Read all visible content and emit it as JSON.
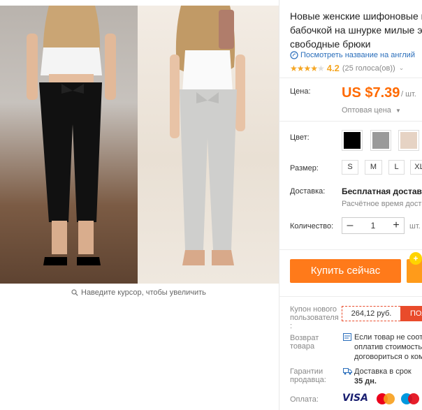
{
  "product": {
    "title_lines": [
      "Новые женские шифоновые ш",
      "бабочкой на шнурке милые эл",
      "свободные брюки"
    ],
    "translate_link": "Посмотреть название на англий",
    "rating_value": "4.2",
    "rating_votes": "(25 голоса(ов))",
    "rating_stars": 4.2
  },
  "gallery": {
    "zoom_hint": "Наведите курсор, чтобы увеличить"
  },
  "price": {
    "label": "Цена:",
    "value": "US $7.39",
    "unit": "/ шт.",
    "wholesale": "Оптовая цена"
  },
  "color": {
    "label": "Цвет:",
    "swatches": [
      "#000000",
      "#9a9a9a",
      "#e6d3c4"
    ]
  },
  "size": {
    "label": "Размер:",
    "options": [
      "S",
      "M",
      "L",
      "XL"
    ]
  },
  "shipping": {
    "label": "Доставка:",
    "value": "Бесплатная доставка",
    "sub": "Расчётное время доста"
  },
  "quantity": {
    "label": "Количество:",
    "value": "1",
    "unit": "шт.",
    "minus": "–",
    "plus": "+"
  },
  "actions": {
    "buy_now": "Купить сейчас"
  },
  "coupon": {
    "label_lines": [
      "Купон нового",
      "пользователя",
      ":"
    ],
    "amount": "264,12 руб.",
    "get": "ПОЛ"
  },
  "returns": {
    "label_lines": [
      "Возврат",
      "товара"
    ],
    "text_lines": [
      "Если товар не соотв",
      "оплатив стоимость",
      "договориться о ком"
    ]
  },
  "guarantee": {
    "label_lines": [
      "Гарантии",
      "продавца:"
    ],
    "text_line1": "Доставка в срок",
    "text_line2": "35 дн."
  },
  "payment": {
    "label": "Оплата:",
    "methods": [
      "VISA",
      "MasterCard",
      "Maestro"
    ]
  },
  "colors": {
    "accent": "#ff6a00",
    "buy_button": "#ff7a1a",
    "link": "#2a6ebb",
    "coupon": "#e94b2b"
  }
}
